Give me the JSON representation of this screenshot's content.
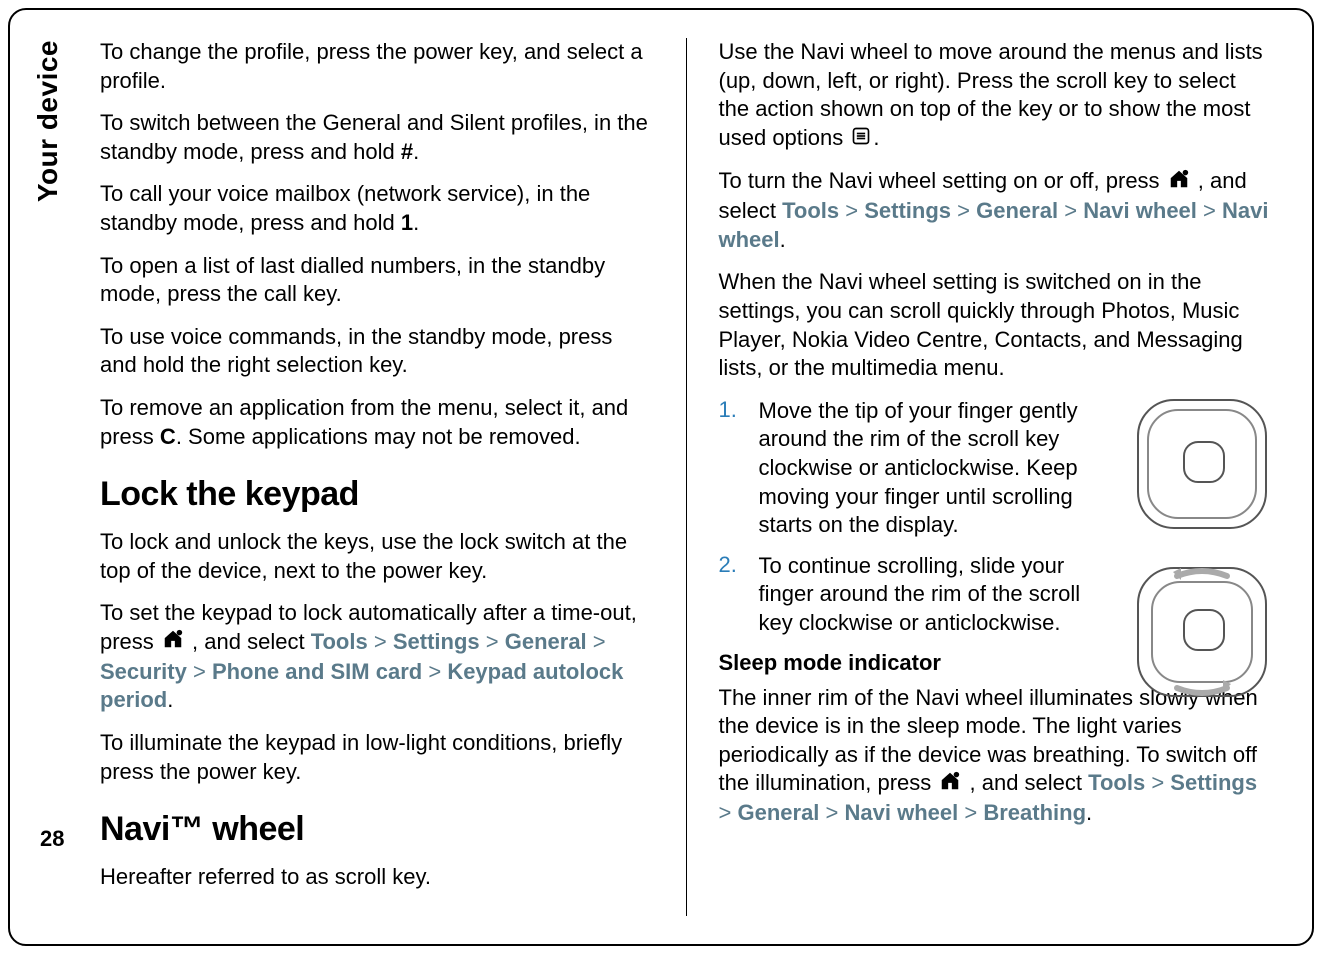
{
  "side_label": "Your device",
  "page_number": "28",
  "left": {
    "p1": "To change the profile, press the power key, and select a profile.",
    "p2_pre": "To switch between the General and Silent profiles, in the standby mode, press and hold ",
    "p2_key": "#",
    "p2_post": ".",
    "p3_pre": "To call your voice mailbox (network service), in the standby mode, press and hold ",
    "p3_key": "1",
    "p3_post": ".",
    "p4": "To open a list of last dialled numbers, in the standby mode, press the call key.",
    "p5": "To use voice commands, in the standby mode, press and hold the right selection key.",
    "p6_pre": "To remove an application from the menu, select it, and press ",
    "p6_key": "C",
    "p6_post": ". Some applications may not be removed.",
    "h_lock": "Lock the keypad",
    "lock_p1": "To lock and unlock the keys, use the lock switch at the top of the device, next to the power key.",
    "lock_p2_pre": "To set the keypad to lock automatically after a time-out, press ",
    "lock_p2_mid": " , and select ",
    "path_tools": "Tools",
    "path_settings": "Settings",
    "path_general": "General",
    "path_security": "Security",
    "path_phone_sim": "Phone and SIM card",
    "path_autolock": "Keypad autolock period",
    "sep": ">",
    "dot": ".",
    "lock_p3": "To illuminate the keypad in low-light conditions, briefly press the power key.",
    "h_navi": "Navi™ wheel",
    "navi_p1": "Hereafter referred to as scroll key."
  },
  "right": {
    "p1_pre": "Use the Navi wheel to move around the menus and lists (up, down, left, or right). Press the scroll key to select the action shown on top of the key or to show the most used options ",
    "p1_post": ".",
    "p2_pre": "To turn the Navi wheel setting on or off, press ",
    "p2_mid": " , and select ",
    "path_tools": "Tools",
    "path_settings": "Settings",
    "path_general": "General",
    "path_navi_wheel": "Navi wheel",
    "sep": ">",
    "dot": ".",
    "p3": "When the Navi wheel setting is switched on in the settings, you can scroll quickly through Photos, Music Player, Nokia Video Centre, Contacts, and Messaging lists, or the multimedia menu.",
    "step1_num": "1.",
    "step1": "Move the tip of your finger gently around the rim of the scroll key clockwise or anticlockwise. Keep moving your finger until scrolling starts on the display.",
    "step2_num": "2.",
    "step2": "To continue scrolling, slide your finger around the rim of the scroll key clockwise or anticlockwise.",
    "h_sleep": "Sleep mode indicator",
    "sleep_p1": "The inner rim of the Navi wheel illuminates slowly when the device is in the sleep mode. The light varies periodically as if the device was breathing. To switch off the illumination, press ",
    "sleep_p1_mid": " , and select ",
    "path_breathing": "Breathing"
  },
  "icons": {
    "home": "home-icon",
    "menu": "menu-icon",
    "navi1": "navi-wheel-figure-1",
    "navi2": "navi-wheel-figure-2"
  }
}
